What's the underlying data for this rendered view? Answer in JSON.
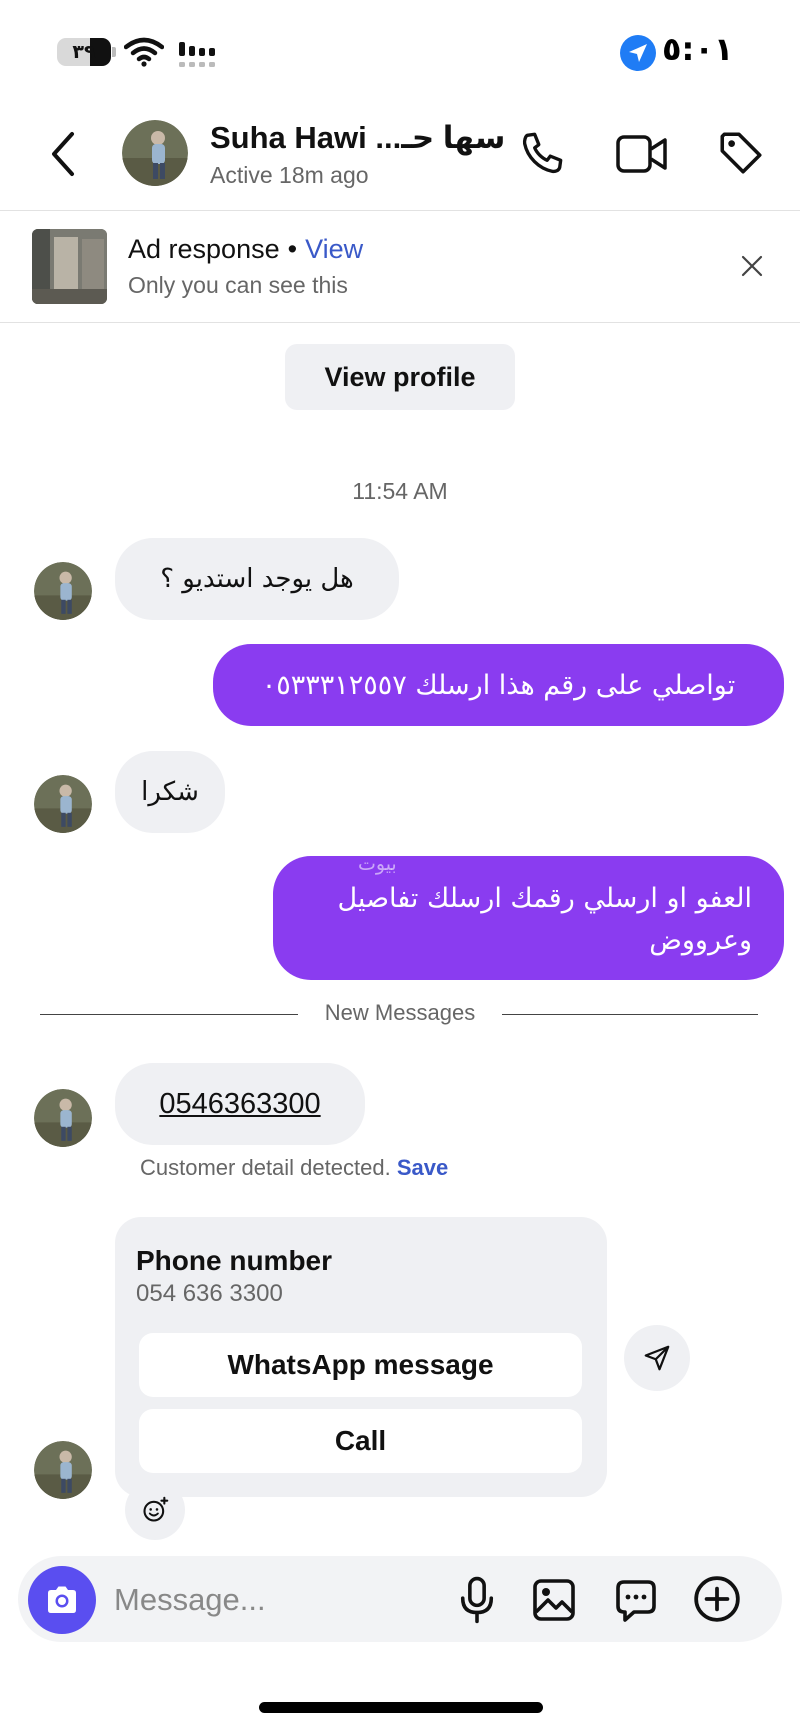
{
  "status_bar": {
    "battery_text": "٣٩",
    "battery_level": 0.39,
    "time": "٥:٠١"
  },
  "header": {
    "name": "Suha Hawi ...سها حـ",
    "status": "Active 18m ago",
    "icons": [
      "back-icon",
      "phone-icon",
      "video-icon",
      "tag-icon"
    ]
  },
  "ad_banner": {
    "title": "Ad response",
    "separator": "•",
    "view_label": "View",
    "subtitle": "Only you can see this"
  },
  "view_profile_label": "View profile",
  "timestamp": "11:54 AM",
  "messages": [
    {
      "direction": "in",
      "text": "هل يوجد استديو ؟"
    },
    {
      "direction": "out",
      "text": "تواصلي على رقم هذا ارسلك ٠٥٣٣٣١٢٥٥٧"
    },
    {
      "direction": "in",
      "text": "شكرا"
    },
    {
      "direction": "out",
      "text": "العفو او ارسلي رقمك ارسلك تفاصيل وعرووض"
    }
  ],
  "watermark": "بيوت",
  "new_messages_label": "New Messages",
  "phone_message": "0546363300",
  "customer_detected": {
    "text": "Customer detail detected.",
    "save_label": "Save"
  },
  "phone_card": {
    "title": "Phone number",
    "number": "054 636 3300",
    "whatsapp_label": "WhatsApp message",
    "call_label": "Call"
  },
  "composer": {
    "placeholder": "Message..."
  },
  "colors": {
    "outgoing_bubble": "#8a3cf0",
    "incoming_bubble": "#eff0f3",
    "link_blue": "#3a59c8",
    "camera_button": "#5a4ef0",
    "location_blue": "#1f7cf5"
  }
}
